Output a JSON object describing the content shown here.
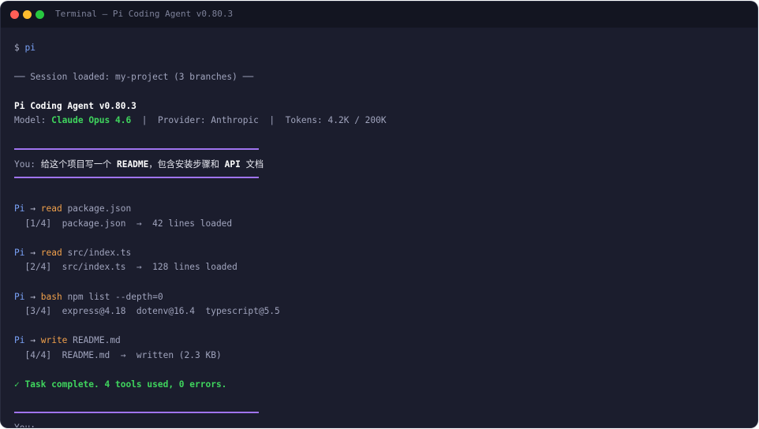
{
  "window": {
    "title": "Terminal — Pi Coding Agent v0.80.3"
  },
  "terminal": {
    "prompt_symbol": "$",
    "prompt_command": "pi",
    "session_line": "── Session loaded: my-project (3 branches) ──",
    "app_title": "Pi Coding Agent v0.80.3",
    "model_label": "Model:",
    "model_name": "Claude Opus 4.6",
    "separator1": "|",
    "provider_text": "Provider: Anthropic",
    "separator2": "|",
    "tokens_text": "Tokens: 4.2K / 200K",
    "user_label": "You:",
    "user_msg_part1": "给这个项目写一个",
    "user_msg_readme": "README",
    "user_msg_part2": "，包含安装步骤和",
    "user_msg_api": "API",
    "user_msg_part3": "文档",
    "steps": [
      {
        "agent": "Pi",
        "arrow": "→",
        "tool": "read",
        "arg": "package.json",
        "result": "  [1/4]  package.json  →  42 lines loaded"
      },
      {
        "agent": "Pi",
        "arrow": "→",
        "tool": "read",
        "arg": "src/index.ts",
        "result": "  [2/4]  src/index.ts  →  128 lines loaded"
      },
      {
        "agent": "Pi",
        "arrow": "→",
        "tool": "bash",
        "arg": "npm list --depth=0",
        "result": "  [3/4]  express@4.18  dotenv@16.4  typescript@5.5"
      },
      {
        "agent": "Pi",
        "arrow": "→",
        "tool": "write",
        "arg": "README.md",
        "result": "  [4/4]  README.md  →  written (2.3 KB)"
      }
    ],
    "complete_line": "✓ Task complete. 4 tools used, 0 errors.",
    "next_prompt_label": "You:"
  },
  "colors": {
    "background": "#1b1d2d",
    "titlebar": "#131521",
    "accent_blue": "#7aa2f7",
    "accent_green": "#3fd45d",
    "accent_orange": "#f0a04b",
    "rule_purple": "#a074f0"
  }
}
